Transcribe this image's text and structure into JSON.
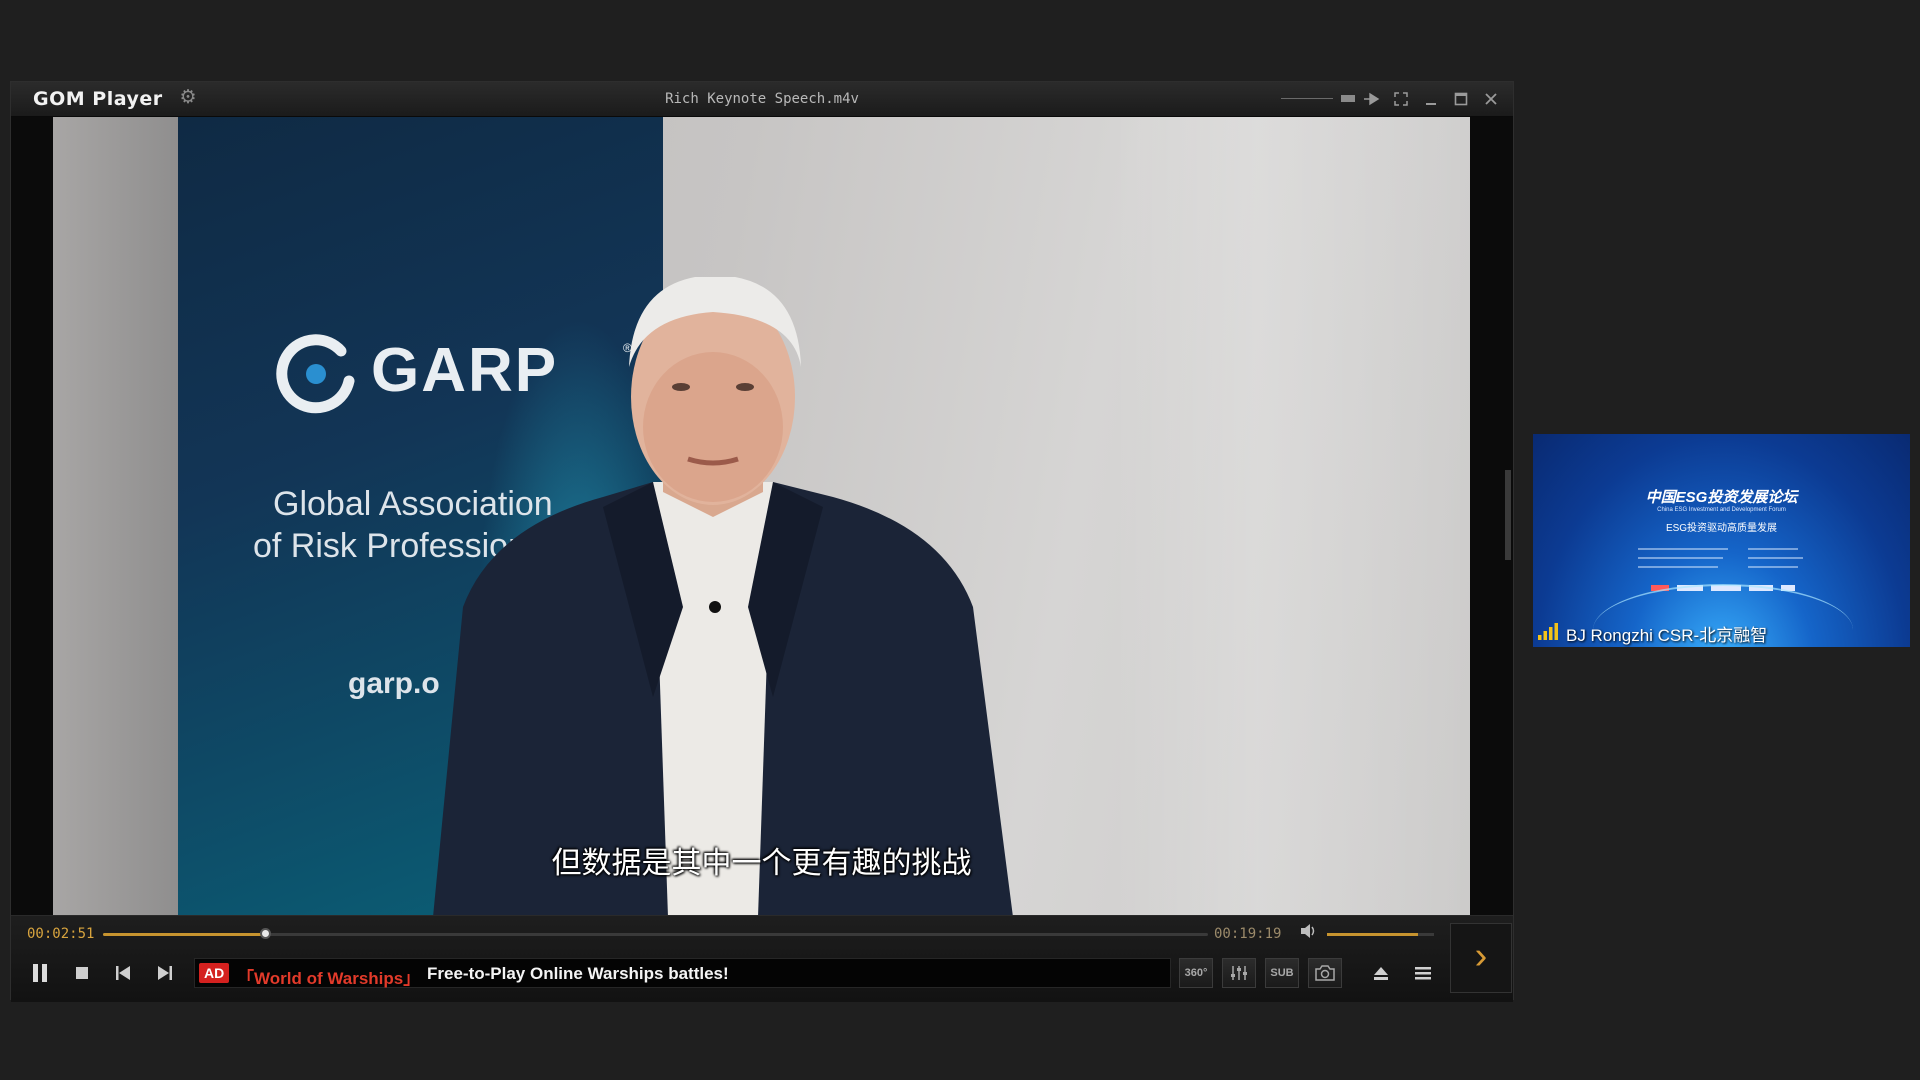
{
  "player": {
    "app_name": "GOM Player",
    "file_name": "Rich Keynote Speech.m4v",
    "subtitle": "但数据是其中一个更有趣的挑战"
  },
  "video_scene": {
    "banner_brand": "GARP",
    "banner_reg": "®",
    "banner_line1": "Global Association",
    "banner_line2": "of Risk Professionals",
    "banner_url": "garp.o"
  },
  "controls": {
    "current_time": "00:02:51",
    "total_time": "00:19:19",
    "progress_fraction": 0.147,
    "volume_fraction": 0.85,
    "btn_360": "360°",
    "btn_sub": "SUB",
    "ad": {
      "badge": "AD",
      "game": "「World of Warships」",
      "text": "Free-to-Play Online Warships battles!"
    }
  },
  "participant": {
    "name": "BJ Rongzhi CSR-北京融智",
    "slide_title": "中国ESG投资发展论坛",
    "slide_subtitle": "China ESG Investment and Development Forum",
    "slide_theme": "ESG投资驱动高质量发展"
  },
  "colors": {
    "accent": "#c7942f",
    "ad_red": "#d4211f"
  },
  "icons": [
    "gear-icon",
    "minimize-icon",
    "maximize-icon",
    "close-icon",
    "pause-icon",
    "stop-icon",
    "prev-icon",
    "next-icon",
    "volume-icon",
    "eject-icon",
    "menu-icon",
    "playlist-arrow-icon",
    "signal-icon",
    "camera-icon",
    "equalizer-icon"
  ]
}
